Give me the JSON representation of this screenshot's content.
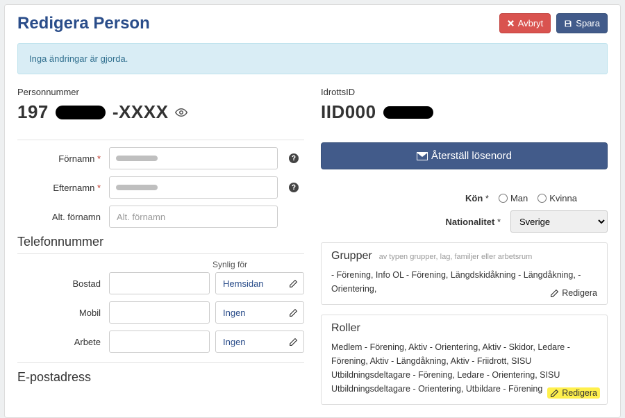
{
  "header": {
    "title": "Redigera Person",
    "cancel": "Avbryt",
    "save": "Spara"
  },
  "banner": "Inga ändringar är gjorda.",
  "left": {
    "personnummer_label": "Personnummer",
    "personnummer_prefix": "197",
    "personnummer_suffix": "-XXXX",
    "firstname_label": "Förnamn",
    "lastname_label": "Efternamn",
    "altname_label": "Alt. förnamn",
    "altname_placeholder": "Alt. förnamn",
    "phone_section": "Telefonnummer",
    "phone_visible_header": "Synlig för",
    "phone_rows": [
      {
        "label": "Bostad",
        "visib": "Hemsidan"
      },
      {
        "label": "Mobil",
        "visib": "Ingen"
      },
      {
        "label": "Arbete",
        "visib": "Ingen"
      }
    ],
    "email_section": "E-postadress"
  },
  "right": {
    "iid_label": "IdrottsID",
    "iid_prefix": "IID000",
    "reset_pw": "Återställ lösenord",
    "gender_label": "Kön",
    "gender_opts": {
      "m": "Man",
      "f": "Kvinna"
    },
    "nat_label": "Nationalitet",
    "nat_value": "Sverige",
    "groups_title": "Grupper",
    "groups_sub": "av typen grupper, lag, familjer eller arbetsrum",
    "groups_body": " - Förening, Info OL - Förening, Längdskidåkning - Längdåkning,  - Orientering, ",
    "groups_edit": "Redigera",
    "roles_title": "Roller",
    "roles_body": "Medlem - Förening, Aktiv - Orientering, Aktiv - Skidor, Ledare - Förening, Aktiv - Längdåkning, Aktiv - Friidrott, SISU Utbildningsdeltagare - Förening, Ledare - Orientering, SISU Utbildningsdeltagare - Orientering, Utbildare - Förening",
    "roles_edit": "Redigera"
  },
  "icons": {
    "close": "✕",
    "save": "💾",
    "help": "?",
    "mail": "✉",
    "pen": "✎"
  }
}
